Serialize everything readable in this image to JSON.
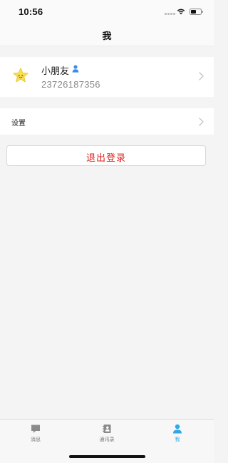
{
  "status_bar": {
    "time": "10:56"
  },
  "nav": {
    "title": "我"
  },
  "profile": {
    "name": "小朋友",
    "phone": "23726187356",
    "avatar_icon": "star-smiley-icon",
    "badge_icon": "user-icon"
  },
  "settings": {
    "label": "设置"
  },
  "logout": {
    "label": "退出登录",
    "color": "#e0201c"
  },
  "tab_bar": {
    "active_color": "#2fa8e8",
    "tabs": [
      {
        "label": "消息",
        "icon": "chat-bubble-icon",
        "active": false
      },
      {
        "label": "通讯录",
        "icon": "address-book-icon",
        "active": false
      },
      {
        "label": "我",
        "icon": "person-icon",
        "active": true
      }
    ]
  }
}
